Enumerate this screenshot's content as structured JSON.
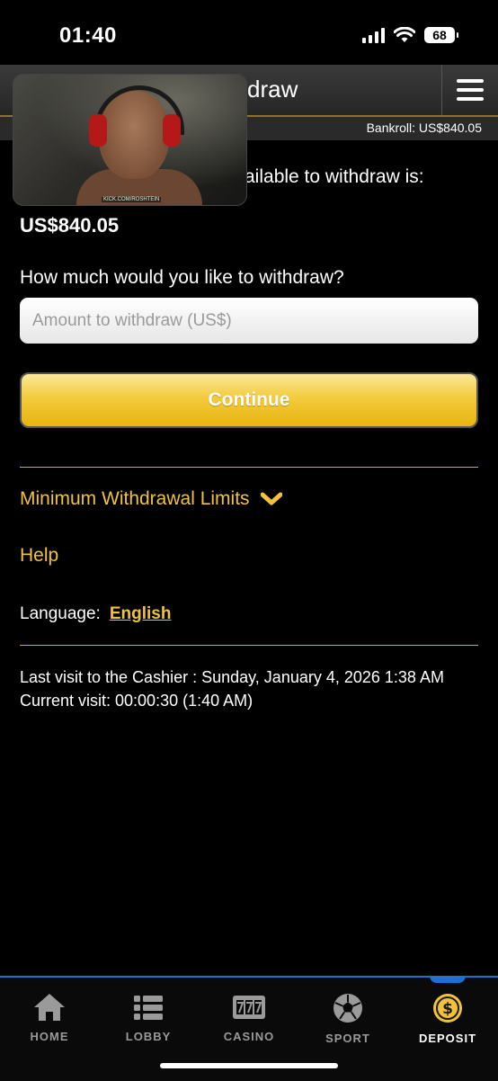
{
  "status_bar": {
    "time": "01:40",
    "battery": "68"
  },
  "header": {
    "title": "draw",
    "bankroll": "Bankroll: US$840.05"
  },
  "webcam": {
    "caption": "KICK.COM/ROSHTEIN"
  },
  "main": {
    "available_label": "ailable to withdraw is:",
    "available_amount": "US$840.05",
    "question": "How much would you like to withdraw?",
    "amount_placeholder": "Amount to withdraw (US$)",
    "continue_label": "Continue",
    "min_limits_label": "Minimum Withdrawal Limits",
    "help_label": "Help",
    "language_label": "Language:",
    "language_value": "English",
    "last_visit": "Last visit to the Cashier : Sunday, January 4, 2026 1:38 AM",
    "current_visit": "Current visit: 00:00:30 (1:40 AM)"
  },
  "nav": {
    "items": [
      {
        "label": "HOME",
        "icon": "home-icon"
      },
      {
        "label": "LOBBY",
        "icon": "lobby-icon"
      },
      {
        "label": "CASINO",
        "icon": "slot-777-icon"
      },
      {
        "label": "SPORT",
        "icon": "soccer-ball-icon"
      },
      {
        "label": "DEPOSIT",
        "icon": "dollar-coin-icon"
      }
    ],
    "active": "DEPOSIT"
  },
  "colors": {
    "accent": "#f2c23a",
    "nav_active_border": "#1d6fd6",
    "button_gold": "#e8b40f"
  }
}
